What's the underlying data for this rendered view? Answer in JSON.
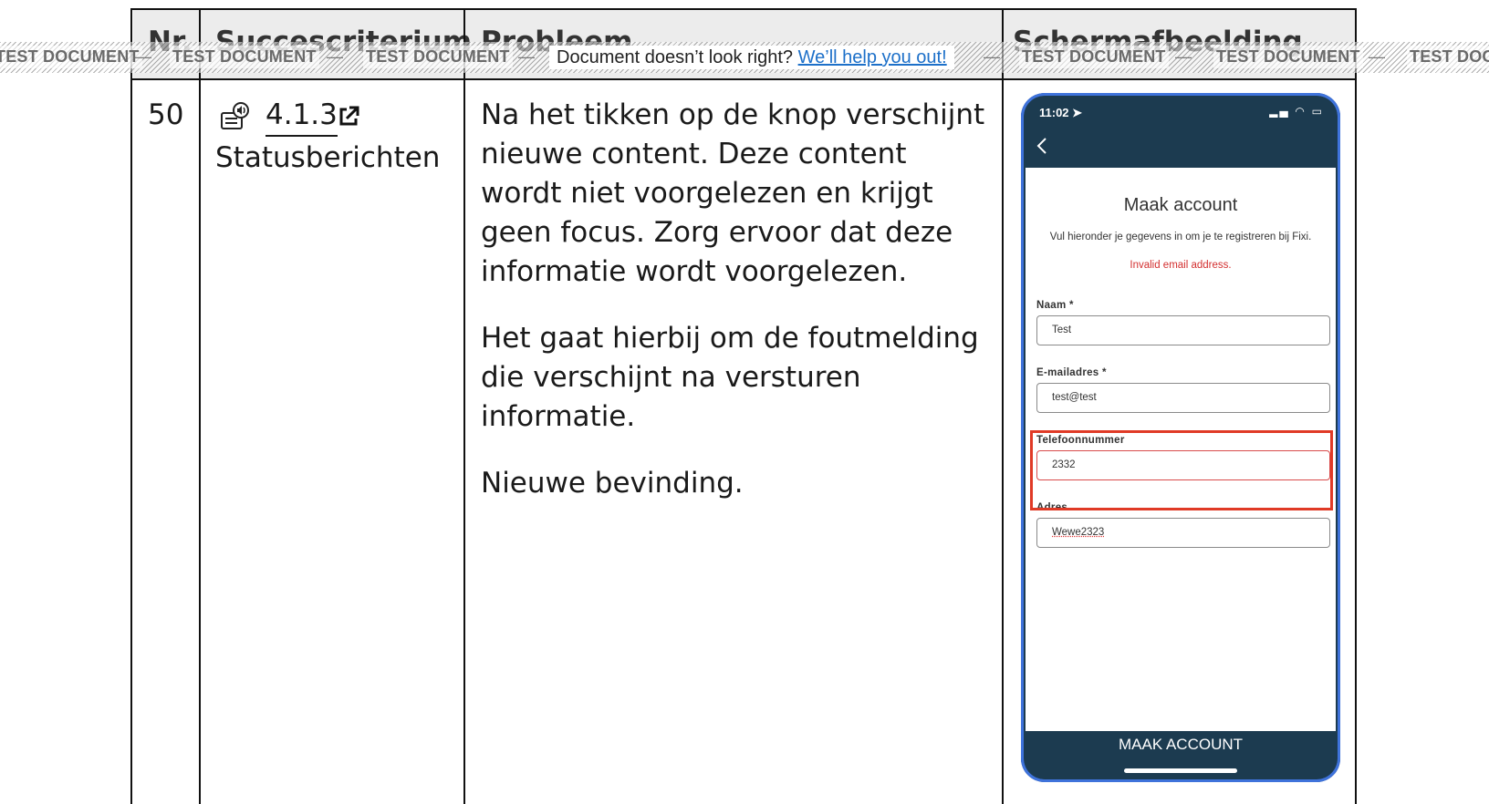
{
  "table": {
    "headers": [
      "Nr.",
      "Succescriterium",
      "Probleem",
      "Schermafbeelding"
    ],
    "row": {
      "nr": "50",
      "criterion_number": "4.1.3",
      "criterion_name": "Statusberichten",
      "problem_paragraphs": [
        "Na het tikken op de knop verschijnt nieuwe content. Deze content wordt niet voorgelezen en krijgt geen focus. Zorg ervoor dat deze informatie wordt voorgelezen.",
        "Het gaat hierbij om de foutmelding die verschijnt na versturen informatie.",
        "Nieuwe bevinding."
      ]
    }
  },
  "banner": {
    "watermark": "TEST DOCUMENT",
    "separator": "—",
    "help_text": "Document doesn’t look right?",
    "help_link": "We’ll help you out!"
  },
  "screenshot": {
    "time": "11:02",
    "title": "Maak account",
    "description": "Vul hieronder je gegevens in om je te registreren bij Fixi.",
    "error": "Invalid email address.",
    "fields": [
      {
        "label": "Naam *",
        "value": "Test"
      },
      {
        "label": "E-mailadres *",
        "value": "test@test"
      },
      {
        "label": "Telefoonnummer",
        "value": "2332"
      },
      {
        "label": "Adres",
        "value": "Wewe2323"
      }
    ],
    "button": "MAAK ACCOUNT"
  },
  "colors": {
    "header_bg": "#ececec",
    "link_blue": "#1d70c9",
    "phone_navy": "#1c3b50",
    "highlight_red": "#e03a26",
    "error_red": "#d32f2f"
  }
}
